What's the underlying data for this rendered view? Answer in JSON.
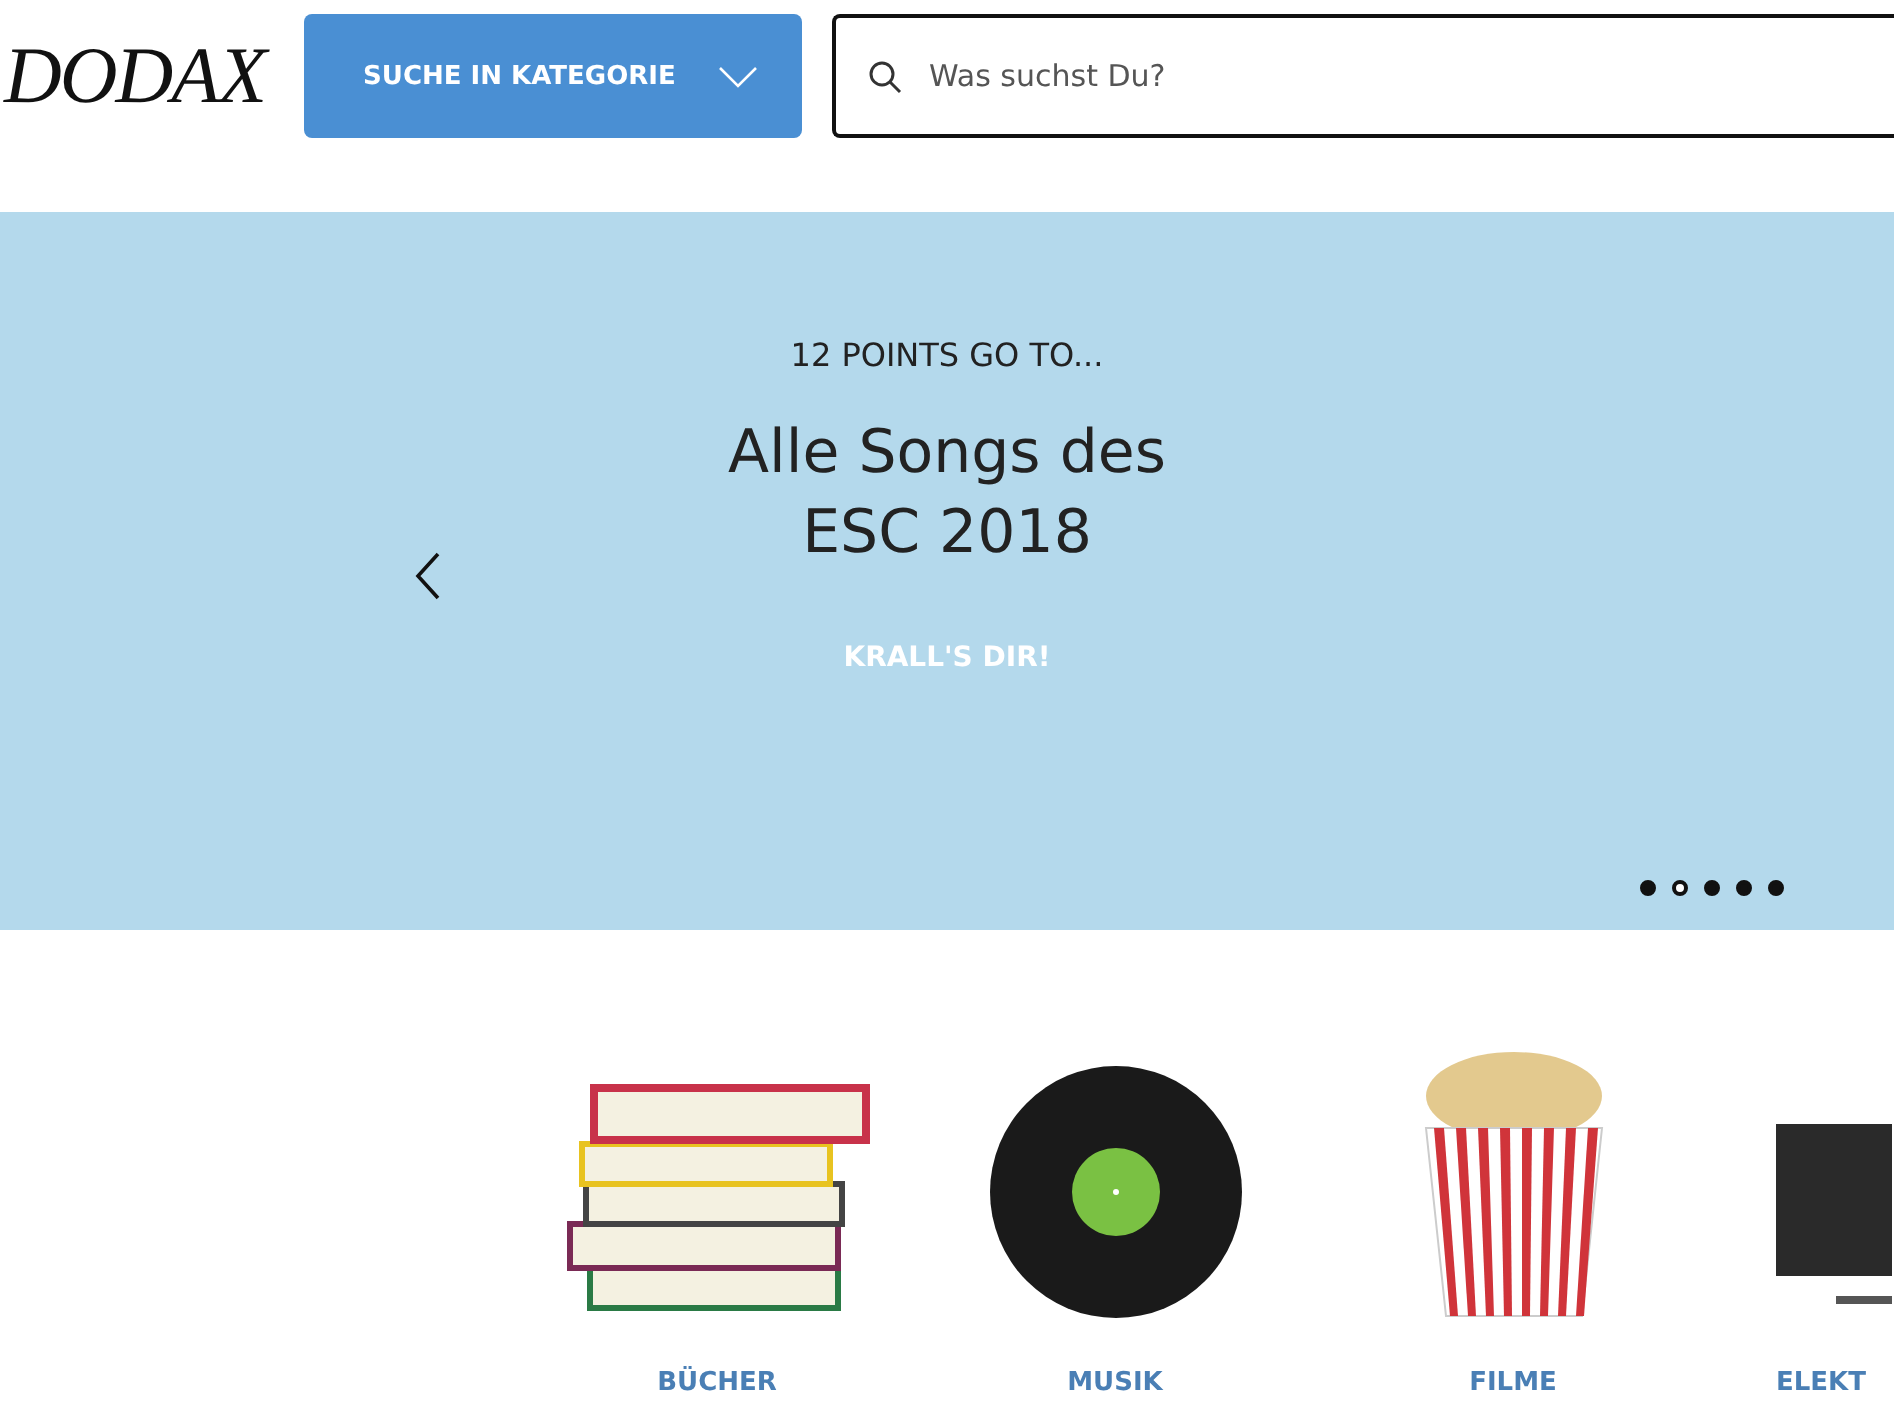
{
  "header": {
    "logo": "DODAX",
    "category_button": {
      "label": "SUCHE IN KATEGORIE"
    },
    "search": {
      "placeholder": "Was suchst Du?"
    }
  },
  "banner": {
    "kicker": "12 POINTS GO TO...",
    "title_lines": [
      "Alle Songs des",
      "ESC 2018"
    ],
    "cta": "KRALL'S DIR!",
    "dots": [
      {
        "selected": false
      },
      {
        "selected": true
      },
      {
        "selected": false
      },
      {
        "selected": false
      },
      {
        "selected": false
      }
    ]
  },
  "categories": [
    {
      "kind": "books",
      "label": "BÜCHER"
    },
    {
      "kind": "record",
      "label": "MUSIK"
    },
    {
      "kind": "popcorn",
      "label": "FILME"
    },
    {
      "kind": "tv",
      "label": "ELEKT"
    }
  ]
}
